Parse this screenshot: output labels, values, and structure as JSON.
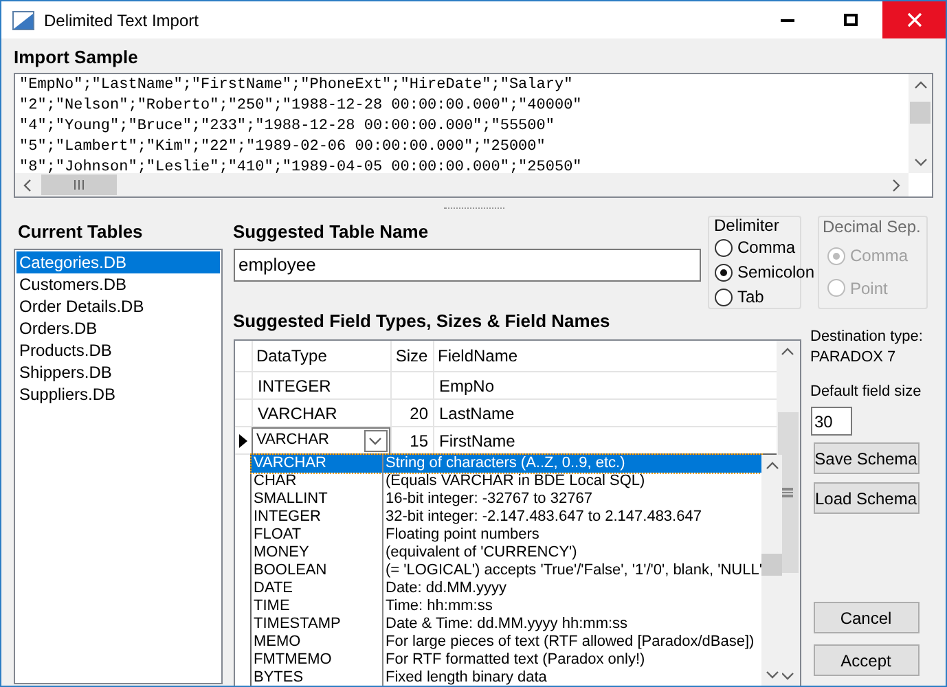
{
  "window": {
    "title": "Delimited Text Import"
  },
  "import_sample": {
    "title": "Import Sample",
    "lines": [
      "\"EmpNo\";\"LastName\";\"FirstName\";\"PhoneExt\";\"HireDate\";\"Salary\"",
      "\"2\";\"Nelson\";\"Roberto\";\"250\";\"1988-12-28 00:00:00.000\";\"40000\"",
      "\"4\";\"Young\";\"Bruce\";\"233\";\"1988-12-28 00:00:00.000\";\"55500\"",
      "\"5\";\"Lambert\";\"Kim\";\"22\";\"1989-02-06 00:00:00.000\";\"25000\"",
      "\"8\";\"Johnson\";\"Leslie\";\"410\";\"1989-04-05 00:00:00.000\";\"25050\""
    ]
  },
  "current_tables": {
    "title": "Current Tables",
    "items": [
      {
        "label": "Categories.DB",
        "selected": true
      },
      {
        "label": "Customers.DB",
        "selected": false
      },
      {
        "label": "Order Details.DB",
        "selected": false
      },
      {
        "label": "Orders.DB",
        "selected": false
      },
      {
        "label": "Products.DB",
        "selected": false
      },
      {
        "label": "Shippers.DB",
        "selected": false
      },
      {
        "label": "Suppliers.DB",
        "selected": false
      }
    ]
  },
  "table_name": {
    "label": "Suggested Table Name",
    "value": "employee"
  },
  "delimiter": {
    "title": "Delimiter",
    "options": [
      {
        "label": "Comma",
        "selected": false
      },
      {
        "label": "Semicolon",
        "selected": true
      },
      {
        "label": "Tab",
        "selected": false
      }
    ]
  },
  "decimal_sep": {
    "title": "Decimal Sep.",
    "disabled": true,
    "options": [
      {
        "label": "Comma",
        "selected": true
      },
      {
        "label": "Point",
        "selected": false
      }
    ]
  },
  "field_grid": {
    "title": "Suggested Field Types, Sizes & Field Names",
    "columns": [
      "DataType",
      "Size",
      "FieldName"
    ],
    "rows": [
      {
        "data_type": "INTEGER",
        "size": "",
        "field_name": "EmpNo",
        "current": false
      },
      {
        "data_type": "VARCHAR",
        "size": "20",
        "field_name": "LastName",
        "current": false
      },
      {
        "data_type": "VARCHAR",
        "size": "15",
        "field_name": "FirstName",
        "current": true
      }
    ]
  },
  "type_dropdown": {
    "items": [
      {
        "type": "VARCHAR",
        "description": "String of characters (A..Z, 0..9, etc.)",
        "selected": true
      },
      {
        "type": "CHAR",
        "description": "(Equals VARCHAR in BDE Local SQL)",
        "selected": false
      },
      {
        "type": "SMALLINT",
        "description": "16-bit integer: -32767 to 32767",
        "selected": false
      },
      {
        "type": "INTEGER",
        "description": "32-bit integer: -2.147.483.647 to 2.147.483.647",
        "selected": false
      },
      {
        "type": "FLOAT",
        "description": "Floating point numbers",
        "selected": false
      },
      {
        "type": "MONEY",
        "description": "(equivalent of  'CURRENCY')",
        "selected": false
      },
      {
        "type": "BOOLEAN",
        "description": "(= 'LOGICAL') accepts 'True'/'False', '1'/'0', blank, 'NULL'",
        "selected": false
      },
      {
        "type": "DATE",
        "description": "Date: dd.MM.yyyy",
        "selected": false
      },
      {
        "type": "TIME",
        "description": "Time: hh:mm:ss",
        "selected": false
      },
      {
        "type": "TIMESTAMP",
        "description": "Date & Time: dd.MM.yyyy hh:mm:ss",
        "selected": false
      },
      {
        "type": "MEMO",
        "description": "For large pieces of text (RTF allowed [Paradox/dBase])",
        "selected": false
      },
      {
        "type": "FMTMEMO",
        "description": "For RTF formatted text (Paradox only!)",
        "selected": false
      },
      {
        "type": "BYTES",
        "description": "Fixed length binary data",
        "selected": false
      }
    ]
  },
  "destination": {
    "label": "Destination type:",
    "value": "PARADOX 7"
  },
  "default_field_size": {
    "label": "Default field size",
    "value": "30"
  },
  "buttons": {
    "save_schema": "Save Schema",
    "load_schema": "Load Schema",
    "cancel": "Cancel",
    "accept": "Accept"
  }
}
